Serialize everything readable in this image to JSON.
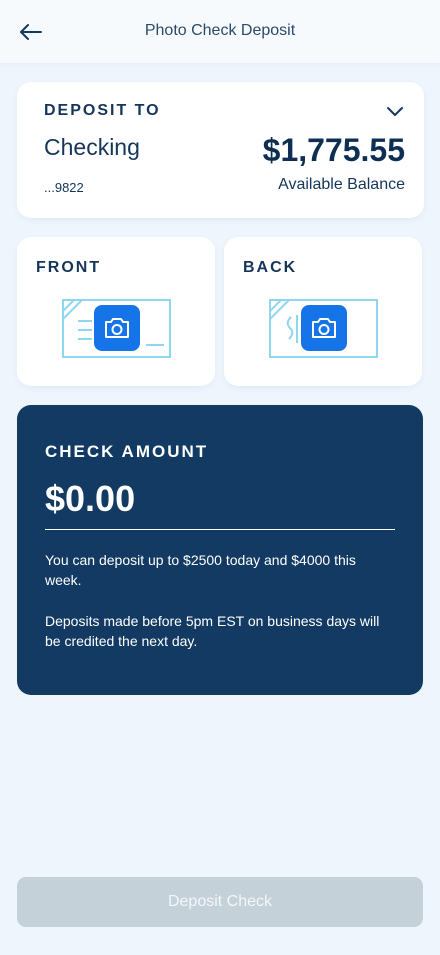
{
  "header": {
    "title": "Photo Check Deposit",
    "back_icon": "arrow-left-icon"
  },
  "deposit_to": {
    "label": "DEPOSIT TO",
    "account_name": "Checking",
    "account_number": "...9822",
    "balance": "$1,775.55",
    "balance_label": "Available Balance",
    "dropdown_icon": "chevron-down-icon"
  },
  "photos": {
    "front_label": "FRONT",
    "back_label": "BACK",
    "camera_icon": "camera-icon"
  },
  "amount": {
    "label": "CHECK AMOUNT",
    "value": "$0.00",
    "limit_text": "You can deposit up to $2500 today and $4000 this week.",
    "cutoff_text": "Deposits made before 5pm EST on business days will be credited the next day."
  },
  "footer": {
    "deposit_button_label": "Deposit Check"
  },
  "colors": {
    "background": "#eef5fd",
    "primary_dark": "#123a62",
    "accent_blue": "#1574e8",
    "check_outline": "#8fd7f0",
    "button_disabled": "#c4d1d9"
  }
}
